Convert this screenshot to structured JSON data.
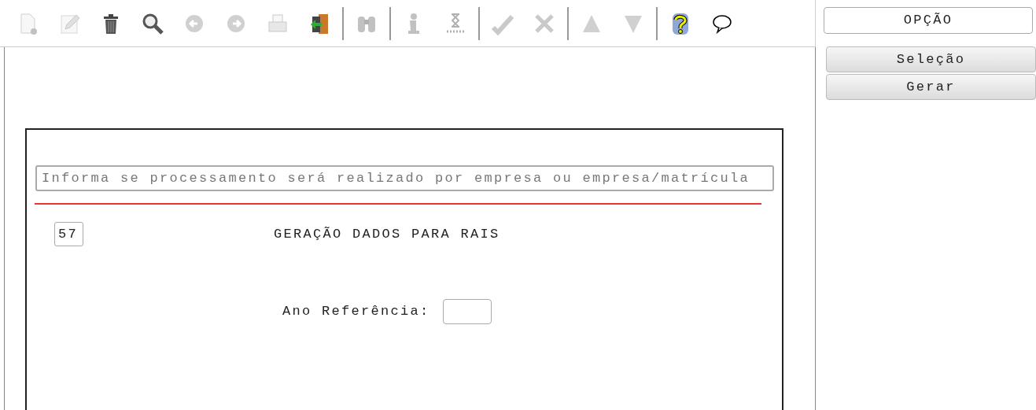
{
  "toolbar": {
    "groups": [
      [
        {
          "kind": "new-document",
          "disabled": true
        },
        {
          "kind": "pencil",
          "disabled": true
        },
        {
          "kind": "trash",
          "disabled": false
        },
        {
          "kind": "search",
          "disabled": false
        },
        {
          "kind": "left-arrow",
          "disabled": true
        },
        {
          "kind": "right-arrow",
          "disabled": true
        },
        {
          "kind": "printer",
          "disabled": true
        },
        {
          "kind": "exit-door",
          "disabled": false
        }
      ],
      [
        {
          "kind": "binoculars",
          "disabled": true
        }
      ],
      [
        {
          "kind": "info",
          "disabled": true
        },
        {
          "kind": "hourglass",
          "disabled": true
        }
      ],
      [
        {
          "kind": "check",
          "disabled": true
        },
        {
          "kind": "cross",
          "disabled": true
        }
      ],
      [
        {
          "kind": "triangle-up",
          "disabled": true
        },
        {
          "kind": "triangle-down",
          "disabled": true
        }
      ],
      [
        {
          "kind": "help",
          "disabled": false
        },
        {
          "kind": "speech-bubble",
          "disabled": false
        }
      ]
    ]
  },
  "form": {
    "hint_field": {
      "placeholder": "Informa se processamento será realizado por empresa ou empresa/matrícula"
    },
    "code_field": {
      "value": "57"
    },
    "title": "GERAÇÃO DADOS PARA RAIS",
    "year_field": {
      "label": "Ano Referência:"
    }
  },
  "side_panel": {
    "header": "OPÇÃO",
    "buttons": [
      "Seleção",
      "Gerar"
    ]
  }
}
